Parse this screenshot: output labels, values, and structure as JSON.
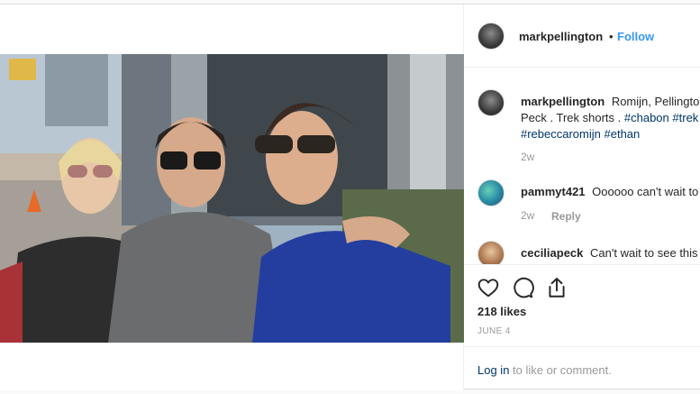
{
  "post": {
    "username": "markpellington",
    "dot": "•",
    "follow_label": "Follow"
  },
  "caption": {
    "username": "markpellington",
    "text": "Romijn, Pellington, Peck . Trek shorts .",
    "tags": [
      "#chabon",
      "#trek",
      "#rebeccaromijn",
      "#ethan"
    ],
    "age": "2w"
  },
  "comments": [
    {
      "username": "pammyt421",
      "text": "Oooooo can't wait to see",
      "age": "2w",
      "reply_label": "Reply"
    },
    {
      "username": "ceciliapeck",
      "text": "Can't wait to see this",
      "age": "",
      "reply_label": ""
    }
  ],
  "actions": {
    "like_icon": "heart-icon",
    "comment_icon": "comment-icon",
    "share_icon": "share-icon",
    "likes": "218 likes",
    "date": "JUNE 4"
  },
  "login": {
    "link": "Log in",
    "rest": " to like or comment."
  },
  "colors": {
    "link_blue": "#3897f0",
    "hashtag": "#003569",
    "muted": "#999999",
    "text": "#262626",
    "border": "#dbdbdb"
  }
}
